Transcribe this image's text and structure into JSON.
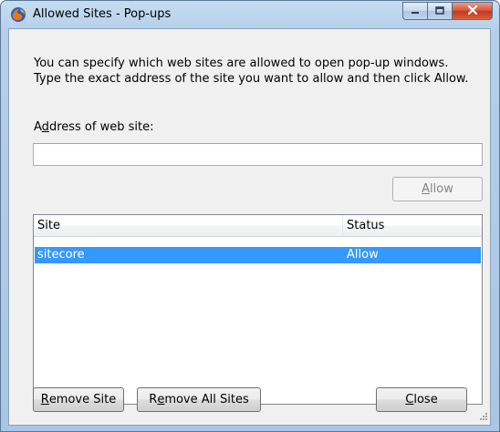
{
  "window": {
    "title": "Allowed Sites - Pop-ups",
    "app_icon": "firefox-icon",
    "title_buttons": [
      "minimize-icon",
      "maximize-icon",
      "close-icon"
    ]
  },
  "dialog": {
    "description": "You can specify which web sites are allowed to open pop-up windows. Type the exact address of the site you want to allow and then click Allow.",
    "address_label": "Address of web site:",
    "address_value": "",
    "allow_label": "Allow"
  },
  "list": {
    "columns": [
      "Site",
      "Status"
    ],
    "rows": [
      {
        "site": "sitecore",
        "status": "Allow",
        "selected": true
      }
    ]
  },
  "buttons": {
    "remove_site": "Remove Site",
    "remove_all_sites": "Remove All Sites",
    "close": "Close"
  },
  "colors": {
    "selection": "#3399ff",
    "titlebar": "#b5cfea",
    "close_button": "#c33819"
  }
}
